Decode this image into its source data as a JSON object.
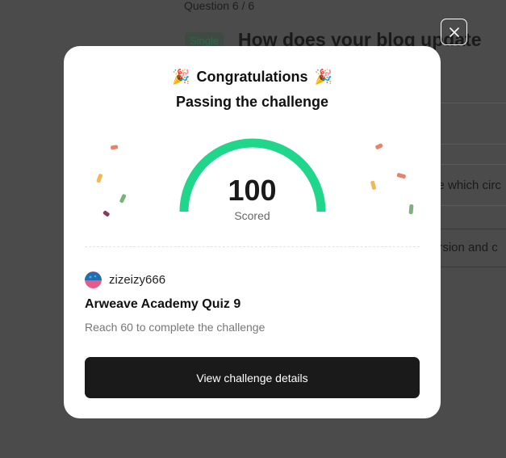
{
  "background": {
    "question_counter": "Question 6 / 6",
    "tag": "Single",
    "question_title": "How does your blog update",
    "option_texts": [
      ".",
      "ve which circ",
      "ersion and c"
    ]
  },
  "modal": {
    "party_emoji": "🎉",
    "title": "Congratulations",
    "subtitle": "Passing the challenge",
    "score": "100",
    "score_label": "Scored",
    "score_progress": 1.0,
    "username": "zizeizy666",
    "quiz_title": "Arweave Academy Quiz 9",
    "quiz_desc": "Reach 60 to complete the challenge",
    "cta_label": "View challenge details"
  },
  "colors": {
    "gauge": "#1fd68a",
    "cta_bg": "#1a1a1a",
    "overlay": "#4b4b4b"
  },
  "icons": {
    "close": "close-icon",
    "party": "party-popper-icon",
    "avatar": "avatar"
  }
}
